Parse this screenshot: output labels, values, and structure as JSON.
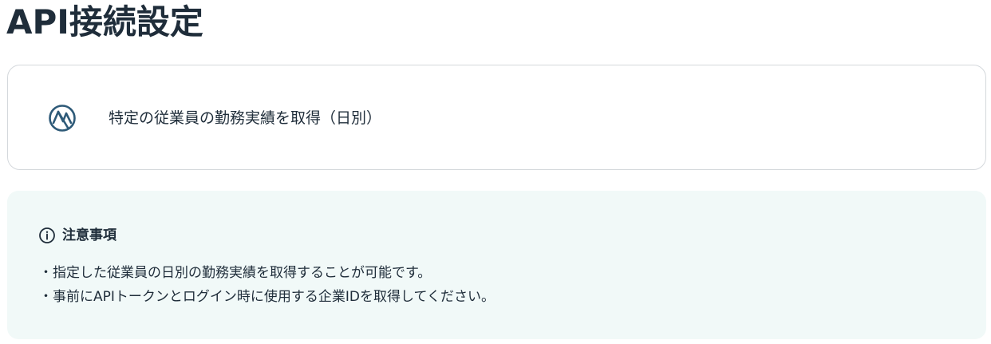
{
  "header": {
    "title": "API接続設定"
  },
  "api_card": {
    "icon": "service-logo-icon",
    "label": "特定の従業員の勤務実績を取得（日別）"
  },
  "notice": {
    "icon": "info-icon",
    "title": "注意事項",
    "items": [
      "・指定した従業員の日別の勤務実績を取得することが可能です。",
      "・事前にAPIトークンとログイン時に使用する企業IDを取得してください。"
    ]
  },
  "colors": {
    "text": "#1f2d3a",
    "logo": "#2e5a78",
    "card_border": "#d4d8dc",
    "notice_bg": "#f1f9f8"
  }
}
